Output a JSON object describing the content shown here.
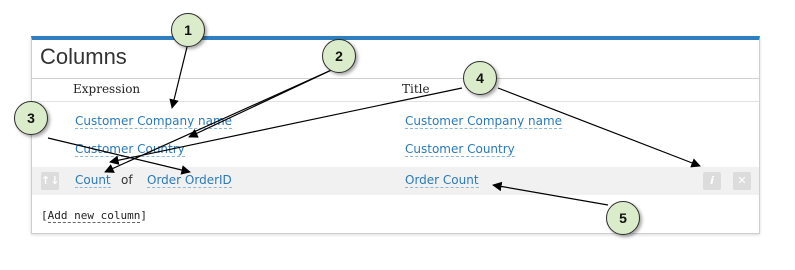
{
  "panel": {
    "title": "Columns",
    "headers": {
      "expression": "Expression",
      "title": "Title"
    }
  },
  "rows": [
    {
      "expression": "Customer Company name",
      "title": "Customer Company name"
    },
    {
      "expression": "Customer Country",
      "title": "Customer Country"
    }
  ],
  "aggregate_row": {
    "function": "Count",
    "of_word": "of",
    "field": "Order OrderID",
    "title": "Order Count",
    "move_icon": "sort-arrows-icon",
    "edit_icon": "edit-icon",
    "delete_icon": "close-icon"
  },
  "add_column": {
    "bracket_open": "[",
    "label": "Add new column",
    "bracket_close": "]"
  },
  "callouts": [
    "1",
    "2",
    "3",
    "4",
    "5"
  ],
  "colors": {
    "accent": "#2f7fc0",
    "link": "#2a7ab8",
    "callout_fill": "#dbeccb"
  }
}
